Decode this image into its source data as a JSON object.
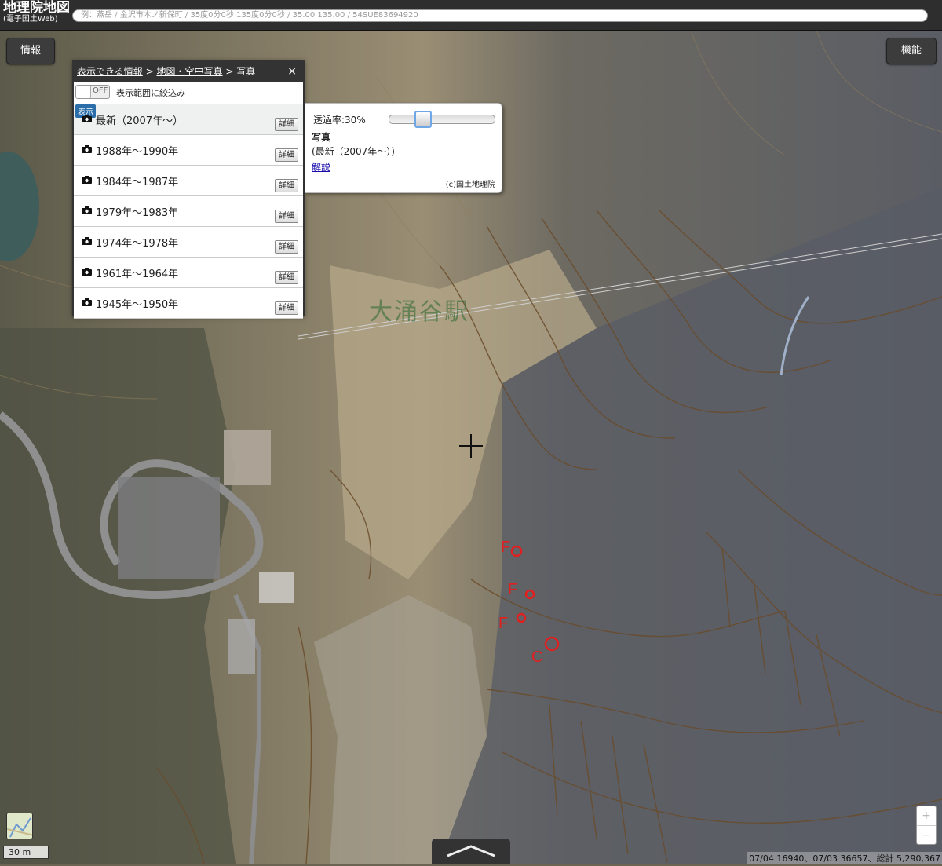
{
  "header": {
    "logo_line1": "地理院地図",
    "logo_line2": "(電子国土Web)",
    "search_placeholder": "例：燕岳 / 金沢市木ノ新保町 / 35度0分0秒 135度0分0秒 / 35.00 135.00 / 54SUE83694920"
  },
  "buttons": {
    "info": "情報",
    "functions": "機能"
  },
  "panel": {
    "breadcrumb": [
      "表示できる情報",
      "地図・空中写真",
      "写真"
    ],
    "separator": ">",
    "close": "×",
    "toggle_state": "OFF",
    "filter_label": "表示範囲に絞込み",
    "show_badge": "表示",
    "detail_label": "詳細",
    "items": [
      {
        "label": "最新（2007年～）",
        "active": true
      },
      {
        "label": "1988年～1990年"
      },
      {
        "label": "1984年～1987年"
      },
      {
        "label": "1979年～1983年"
      },
      {
        "label": "1974年～1978年"
      },
      {
        "label": "1961年～1964年"
      },
      {
        "label": "1945年～1950年"
      }
    ]
  },
  "popup": {
    "opacity_label": "透過率:30%",
    "opacity_value": 0.3,
    "title": "写真",
    "subtitle": "(最新（2007年～）)",
    "link": "解説",
    "credit": "(c)国土地理院"
  },
  "map": {
    "place_label": "大涌谷駅",
    "markers": [
      "F",
      "F",
      "F",
      "C"
    ],
    "scale": "30 m",
    "stats": "07/04 16940、07/03 36657、総計 5,290,367",
    "zoom_in": "+",
    "zoom_out": "−",
    "drawer_icon": "chevron-up"
  }
}
